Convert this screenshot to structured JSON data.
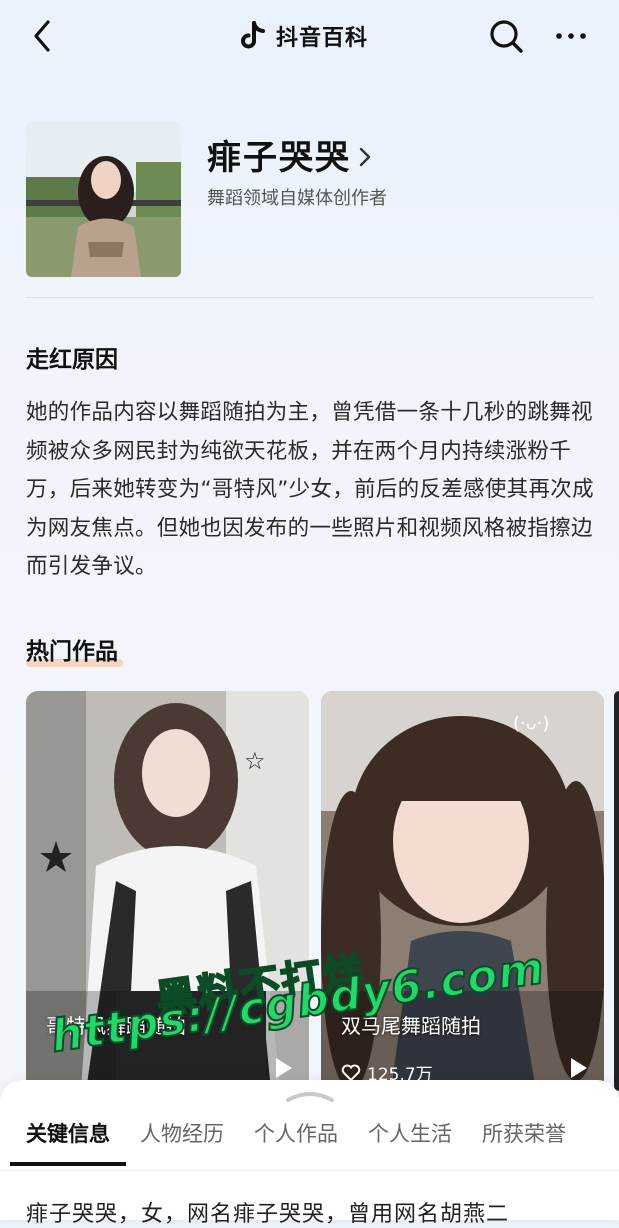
{
  "header": {
    "brand_name": "抖音百科",
    "brand_icon": "tiktok-note-icon",
    "back_icon": "chevron-left-icon",
    "search_icon": "search-icon",
    "more_icon": "more-horizontal-icon"
  },
  "profile": {
    "name": "痱子哭哭",
    "subtitle": "舞蹈领域自媒体创作者"
  },
  "reason": {
    "title": "走红原因",
    "text": "她的作品内容以舞蹈随拍为主，曾凭借一条十几秒的跳舞视频被众多网民封为纯欲天花板，并在两个月内持续涨粉千万，后来她转变为“哥特风”少女，前后的反差感使其再次成为网友焦点。但她也因发布的一些照片和视频风格被指擦边而引发争议。"
  },
  "hot_works": {
    "title": "热门作品",
    "items": [
      {
        "title": "哥特风舞蹈随拍",
        "likes": ""
      },
      {
        "title": "双马尾舞蹈随拍",
        "likes": "125.7万"
      }
    ]
  },
  "watermark": {
    "line1": "黑料不打烊",
    "line2": "https://cgbdy6.com"
  },
  "tabs": [
    "关键信息",
    "人物经历",
    "个人作品",
    "个人生活",
    "所获荣誉"
  ],
  "active_tab": "关键信息",
  "peek_text": "痱子哭哭，女，网名痱子哭哭，曾用网名胡燕二"
}
